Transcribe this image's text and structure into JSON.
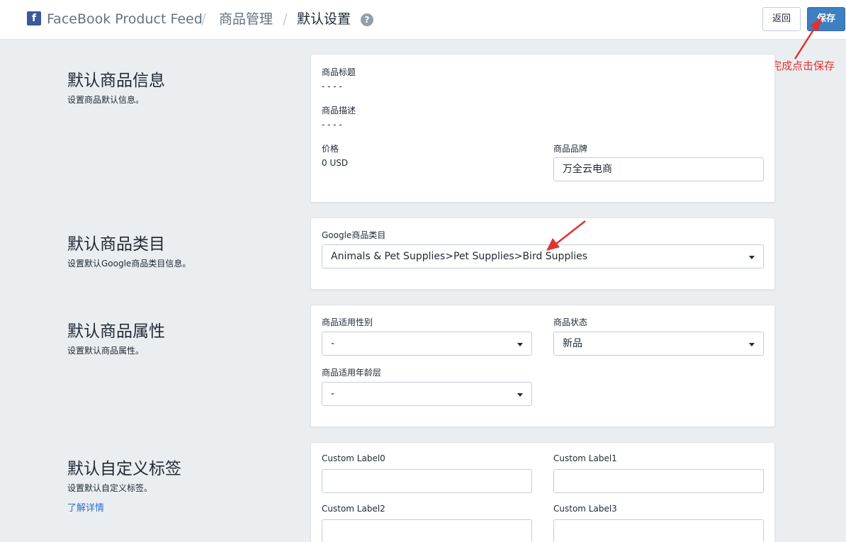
{
  "header": {
    "logo_glyph": "f",
    "app_name": "FaceBook Product Feed",
    "separator": "/",
    "crumb_manage": "商品管理",
    "crumb_current": "默认设置",
    "help_glyph": "?",
    "back_label": "返回",
    "save_label": "保存"
  },
  "annotation": {
    "note": "设置完成点击保存",
    "color": "#e03232"
  },
  "sections": {
    "info": {
      "title": "默认商品信息",
      "desc": "设置商品默认信息。",
      "product_title_label": "商品标题",
      "product_title_value": "- - - -",
      "product_desc_label": "商品描述",
      "product_desc_value": "- - - -",
      "price_label": "价格",
      "price_value": "0 USD",
      "brand_label": "商品品牌",
      "brand_value": "万全云电商"
    },
    "category": {
      "title": "默认商品类目",
      "desc": "设置默认Google商品类目信息。",
      "google_label": "Google商品类目",
      "google_value": "Animals & Pet Supplies>Pet Supplies>Bird Supplies"
    },
    "attributes": {
      "title": "默认商品属性",
      "desc": "设置默认商品属性。",
      "gender_label": "商品适用性别",
      "gender_value": "-",
      "condition_label": "商品状态",
      "condition_value": "新品",
      "age_label": "商品适用年龄层",
      "age_value": "-"
    },
    "labels": {
      "title": "默认自定义标签",
      "desc": "设置默认自定义标签。",
      "learn_more": "了解详情",
      "label0": "Custom Label0",
      "label1": "Custom Label1",
      "label2": "Custom Label2",
      "label3": "Custom Label3",
      "value0": "",
      "value1": "",
      "value2": "",
      "value3": ""
    }
  },
  "colors": {
    "primary": "#3d7fc1",
    "page_bg": "#ebeef0",
    "annotation_red": "#e03232"
  }
}
